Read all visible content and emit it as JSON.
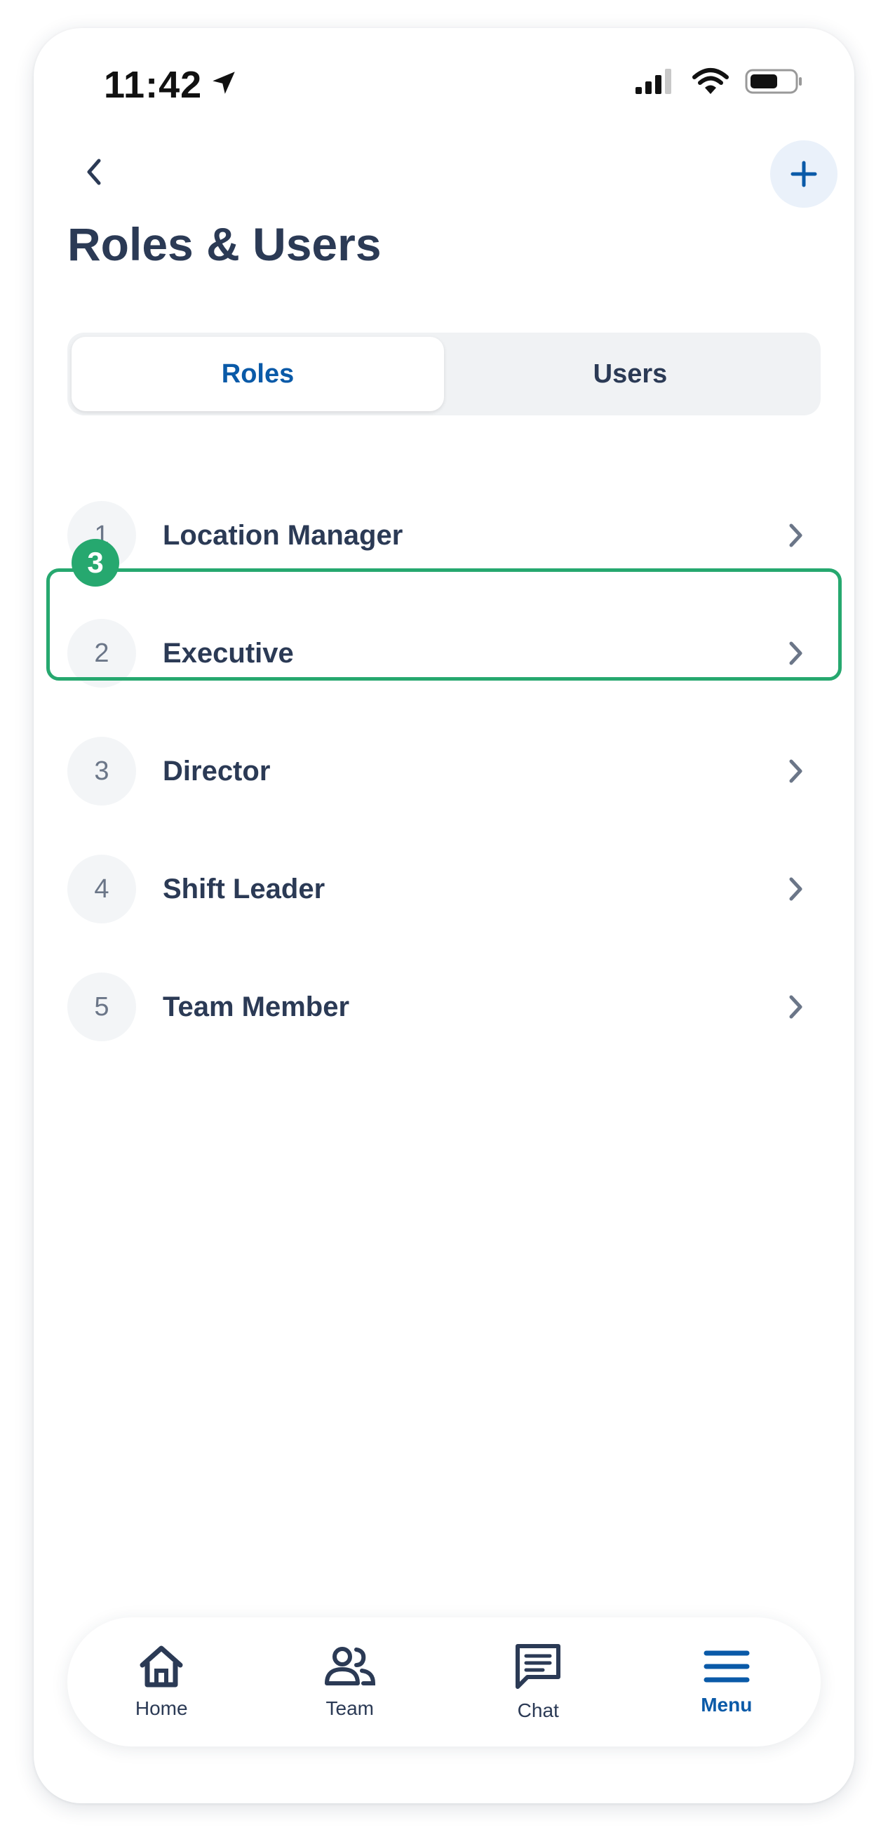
{
  "status_bar": {
    "time": "11:42",
    "icons": [
      "location-arrow-icon",
      "signal-icon",
      "wifi-icon",
      "battery-icon"
    ]
  },
  "header": {
    "back_icon": "chevron-left-icon",
    "add_icon": "plus-icon",
    "title": "Roles & Users"
  },
  "segmented": {
    "tabs": [
      {
        "label": "Roles",
        "active": true
      },
      {
        "label": "Users",
        "active": false
      }
    ]
  },
  "roles": [
    {
      "number": "1",
      "label": "Location Manager"
    },
    {
      "number": "2",
      "label": "Executive"
    },
    {
      "number": "3",
      "label": "Director"
    },
    {
      "number": "4",
      "label": "Shift Leader"
    },
    {
      "number": "5",
      "label": "Team Member"
    }
  ],
  "highlight": {
    "badge": "3",
    "color": "#26a86f"
  },
  "tabbar": {
    "items": [
      {
        "label": "Home",
        "icon": "home-icon"
      },
      {
        "label": "Team",
        "icon": "team-icon"
      },
      {
        "label": "Chat",
        "icon": "chat-icon"
      },
      {
        "label": "Menu",
        "icon": "menu-icon",
        "active": true
      }
    ]
  },
  "colors": {
    "accent": "#0a5aa8",
    "text": "#2b3a55",
    "highlight": "#26a86f"
  }
}
